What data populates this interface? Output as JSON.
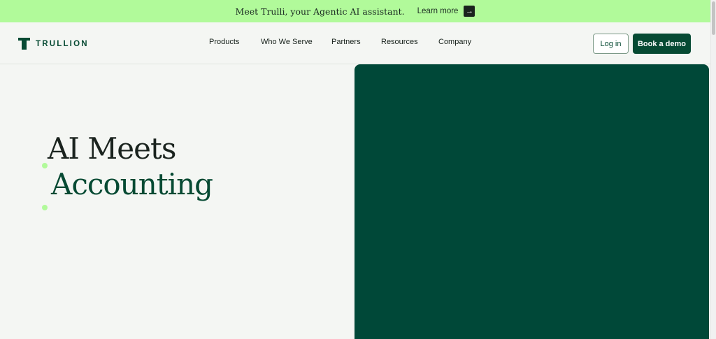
{
  "announcement": {
    "message": "Meet Trulli, your Agentic AI assistant.",
    "link_label": "Learn more",
    "arrow_icon": "arrow-right-icon",
    "background": "#b1fa9a"
  },
  "brand": {
    "name": "TRULLION",
    "color": "#064a33"
  },
  "nav": {
    "items": [
      "Products",
      "Who We Serve",
      "Partners",
      "Resources",
      "Company"
    ],
    "login_label": "Log in",
    "demo_label": "Book a demo"
  },
  "hero": {
    "title_line1": "AI Meets",
    "title_line2": "Accounting",
    "panel_color": "#004838",
    "accent_color": "#b1fa9a"
  }
}
